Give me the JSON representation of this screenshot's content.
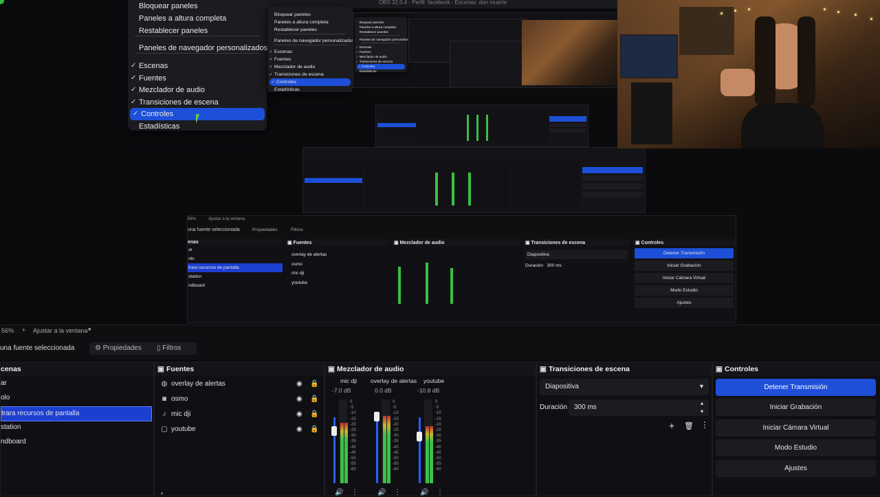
{
  "window": {
    "title": "OBS 32.0.4 - Perfil: facebook - Escenas: don muerte"
  },
  "view_menu": {
    "items": [
      {
        "label": "Bloquear paneles",
        "checked": false
      },
      {
        "label": "Paneles a altura completa",
        "checked": false
      },
      {
        "label": "Restablecer paneles",
        "checked": false
      },
      {
        "label": "Paneles de navegador personalizados...",
        "checked": false
      },
      {
        "label": "Escenas",
        "checked": true
      },
      {
        "label": "Fuentes",
        "checked": true
      },
      {
        "label": "Mezclador de audio",
        "checked": true
      },
      {
        "label": "Transiciones de escena",
        "checked": true
      },
      {
        "label": "Controles",
        "checked": true,
        "highlighted": true
      },
      {
        "label": "Estadísticas",
        "checked": false
      }
    ],
    "check_glyph": "✓"
  },
  "nested_preview": {
    "zoom": "56%",
    "fit_label": "Ajustar a la ventana",
    "no_source": "una fuente seleccionada",
    "properties": "Propiedades",
    "filters": "Filtros",
    "scene_items": [
      "ar",
      "olo",
      "trara recursos de pantalla",
      "station",
      "ndboard"
    ],
    "controls": [
      "Detener Transmisión",
      "Iniciar Grabación",
      "Iniciar Cámara Virtual",
      "Modo Estudio",
      "Ajustes"
    ],
    "transition_value": "Diapositiva",
    "duration_label": "Duración",
    "duration_value": "300 ms"
  },
  "statusbar": {
    "zoom": "56%",
    "plus": "+",
    "fit_label": "Ajustar a la ventana"
  },
  "toolbar": {
    "no_source_label": "una fuente seleccionada",
    "properties_label": "Propiedades",
    "filters_label": "Filtros"
  },
  "scenes": {
    "title": "cenas",
    "items": [
      {
        "label": "ar",
        "selected": false
      },
      {
        "label": "olo",
        "selected": false
      },
      {
        "label": "trara recursos de pantalla",
        "selected": true
      },
      {
        "label": "station",
        "selected": false
      },
      {
        "label": "ndboard",
        "selected": false
      }
    ]
  },
  "sources": {
    "title": "Fuentes",
    "items": [
      {
        "label": "overlay de alertas",
        "icon": "globe-icon",
        "glyph": "◍",
        "visible": true,
        "locked": false
      },
      {
        "label": "osmo",
        "icon": "camera-icon",
        "glyph": "◙",
        "visible": true,
        "locked": false
      },
      {
        "label": "mic dji",
        "icon": "microphone-icon",
        "glyph": "♪",
        "visible": true,
        "locked": true
      },
      {
        "label": "youtube",
        "icon": "window-icon",
        "glyph": "▢",
        "visible": true,
        "locked": false
      }
    ]
  },
  "mixer": {
    "title": "Mezclador de audio",
    "channels": [
      {
        "name": "mic dji",
        "db": "-7.0 dB",
        "level": 0.72,
        "fader": 0.78
      },
      {
        "name": "overlay de alertas",
        "db": "0.0 dB",
        "level": 0.8,
        "fader": 1.0
      },
      {
        "name": "youtube",
        "db": "-10.8 dB",
        "level": 0.68,
        "fader": 0.7
      }
    ],
    "scale": [
      "0",
      "-5",
      "-10",
      "-15",
      "-20",
      "-25",
      "-30",
      "-35",
      "-40",
      "-45",
      "-50",
      "-55",
      "-60"
    ]
  },
  "transitions": {
    "title": "Transiciones de escena",
    "selected": "Diapositiva",
    "duration_label": "Duración",
    "duration_value": "300 ms"
  },
  "controls": {
    "title": "Controles",
    "buttons": [
      "Detener Transmisión",
      "Iniciar Grabación",
      "Iniciar Cámara Virtual",
      "Modo Estudio",
      "Ajustes"
    ]
  },
  "colors": {
    "accent": "#1d4fd8",
    "background": "#0a0a0c",
    "panel": "#101014"
  }
}
